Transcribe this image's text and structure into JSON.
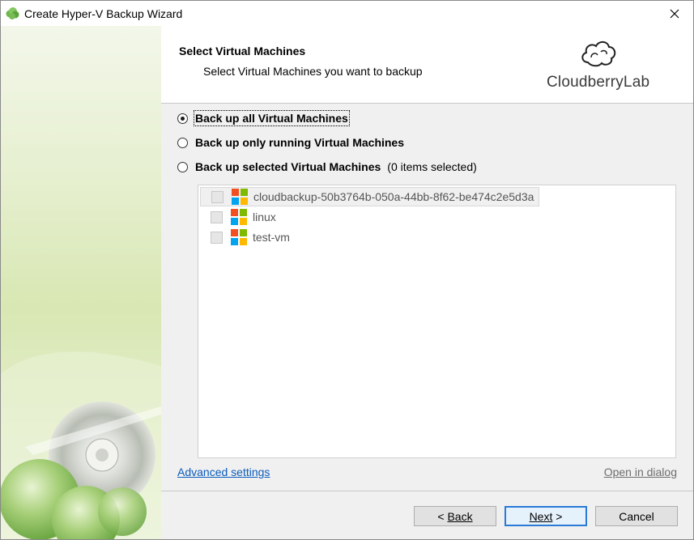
{
  "window": {
    "title": "Create Hyper-V Backup Wizard"
  },
  "header": {
    "title": "Select Virtual Machines",
    "subtitle": "Select Virtual Machines you want to backup",
    "logo_text": "CloudberryLab"
  },
  "options": [
    {
      "label": "Back up all Virtual Machines",
      "checked": true
    },
    {
      "label": "Back up only running Virtual Machines",
      "checked": false
    },
    {
      "label": "Back up selected Virtual Machines",
      "checked": false,
      "note": "(0 items selected)"
    }
  ],
  "vms": [
    {
      "name": "cloudbackup-50b3764b-050a-44bb-8f62-be474c2e5d3a",
      "checked": false,
      "selected": true
    },
    {
      "name": "linux",
      "checked": false,
      "selected": false
    },
    {
      "name": "test-vm",
      "checked": false,
      "selected": false
    }
  ],
  "links": {
    "advanced": "Advanced settings",
    "open_dialog": "Open in dialog"
  },
  "buttons": {
    "back": "Back",
    "next": "Next",
    "cancel": "Cancel"
  },
  "colors": {
    "accent": "#2a7ad6",
    "link": "#0b5bbd",
    "win_red": "#f25022",
    "win_green": "#7fba00",
    "win_blue": "#00a4ef",
    "win_yellow": "#ffb900"
  }
}
